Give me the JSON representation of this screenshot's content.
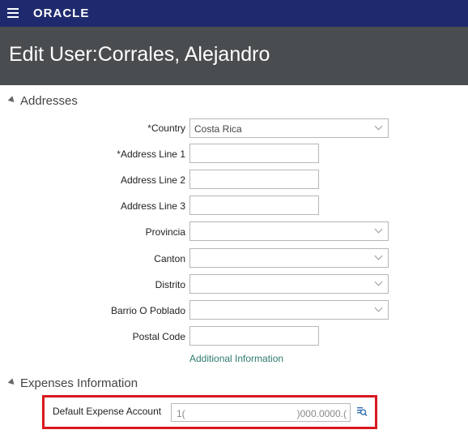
{
  "header": {
    "brand": "ORACLE",
    "menu_icon": "hamburger-menu-icon"
  },
  "page": {
    "title": "Edit User:Corrales, Alejandro"
  },
  "addresses": {
    "section_title": "Addresses",
    "country_label": "Country",
    "country_required": "*",
    "country_value": "Costa Rica",
    "address1_label": "Address Line 1",
    "address1_required": "*",
    "address1_value": "",
    "address2_label": "Address Line 2",
    "address2_value": "",
    "address3_label": "Address Line 3",
    "address3_value": "",
    "provincia_label": "Provincia",
    "provincia_value": "",
    "canton_label": "Canton",
    "canton_value": "",
    "distrito_label": "Distrito",
    "distrito_value": "",
    "barrio_label": "Barrio O Poblado",
    "barrio_value": "",
    "postal_label": "Postal Code",
    "postal_value": "",
    "additional_info_link": "Additional Information"
  },
  "expenses": {
    "section_title": "Expenses Information",
    "default_account_label": "Default Expense Account",
    "default_account_value_left": "1(",
    "default_account_value_right": ")000.0000.(",
    "search_icon": "search-list-icon",
    "highlight_color": "#d9181e"
  },
  "colors": {
    "topbar": "#1f2a6e",
    "titlebar": "#4a4d4f",
    "link": "#2f7b6e"
  }
}
